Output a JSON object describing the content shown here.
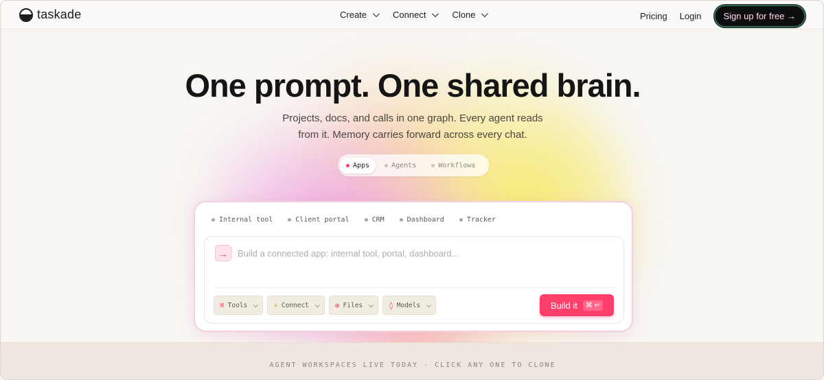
{
  "header": {
    "logo_text": "taskade",
    "menu": [
      {
        "label": "Create"
      },
      {
        "label": "Connect"
      },
      {
        "label": "Clone"
      }
    ],
    "pricing": "Pricing",
    "login": "Login",
    "signup": "Sign up for free →"
  },
  "hero": {
    "headline": "One prompt. One shared brain.",
    "sub_line1": "Projects, docs, and calls in one graph. Every agent reads",
    "sub_line2": "from it. Memory carries forward across every chat.",
    "modes": [
      {
        "label": "Apps",
        "active": true
      },
      {
        "label": "Agents",
        "active": false
      },
      {
        "label": "Workflows",
        "active": false
      }
    ]
  },
  "composer": {
    "chips": [
      "Internal tool",
      "Client portal",
      "CRM",
      "Dashboard",
      "Tracker"
    ],
    "placeholder": "Build a connected app: internal tool, portal, dashboard...",
    "value": "",
    "tools": [
      {
        "label": "Tools",
        "icon": "command-icon"
      },
      {
        "label": "Connect",
        "icon": "bolt-icon"
      },
      {
        "label": "Files",
        "icon": "globe-icon"
      },
      {
        "label": "Models",
        "icon": "diamond-icon"
      }
    ],
    "build_label": "Build it",
    "build_shortcut": "⌘ ↵"
  },
  "footer_band": {
    "text": "AGENT WORKSPACES LIVE TODAY · CLICK ANY ONE TO CLONE"
  },
  "colors": {
    "accent": "#ff3e6a",
    "signup_bg": "#0e0e0e",
    "band_bg": "#efe6df"
  }
}
